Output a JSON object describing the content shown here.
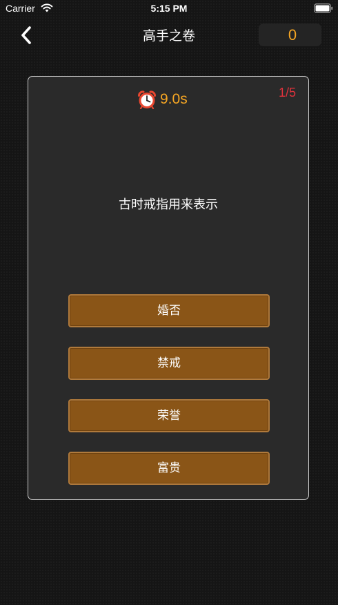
{
  "status_bar": {
    "carrier": "Carrier",
    "time": "5:15 PM"
  },
  "nav": {
    "title": "高手之卷",
    "score": "0",
    "back_icon": "chevron-left-icon"
  },
  "quiz": {
    "timer_icon": "alarm-clock-icon",
    "timer": "9.0s",
    "progress": "1/5",
    "question": "古时戒指用来表示",
    "options": [
      {
        "label": "婚否"
      },
      {
        "label": "禁戒"
      },
      {
        "label": "荣誉"
      },
      {
        "label": "富贵"
      }
    ]
  },
  "colors": {
    "accent": "#f6a623",
    "progress": "#e0323c",
    "option_fill": "#8a5517",
    "option_border": "#b07a3c",
    "card_bg": "#2a2a2a",
    "page_bg": "#151515"
  }
}
